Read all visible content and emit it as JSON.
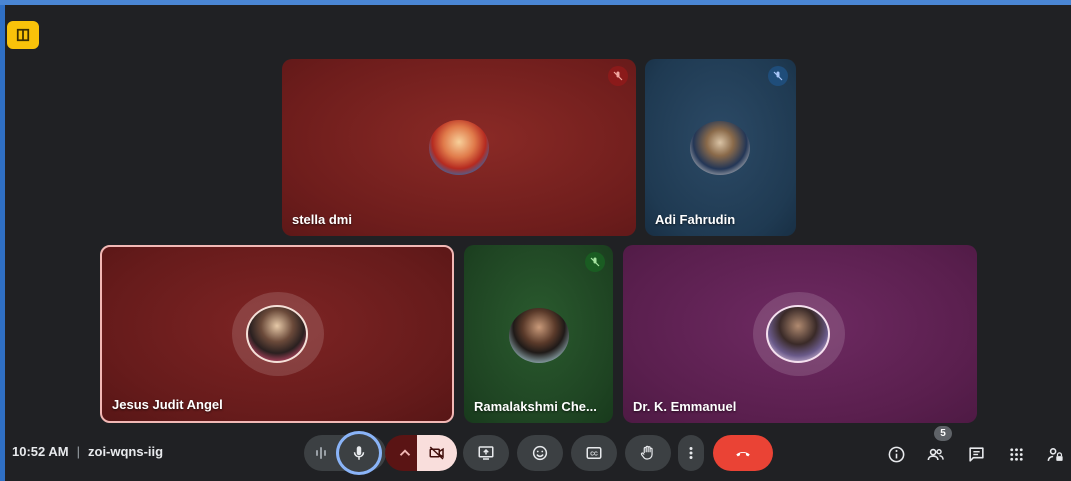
{
  "meeting": {
    "time": "10:52 AM",
    "separator": "|",
    "code": "zoi-wqns-iig"
  },
  "participants": [
    {
      "name": "stella dmi",
      "muted": true,
      "color": "#7a1f1f"
    },
    {
      "name": "Adi Fahrudin",
      "muted": true,
      "color": "#1f3a52"
    },
    {
      "name": "Jesus Judit Angel",
      "muted": false,
      "color": "#6b1a1a",
      "speaking": true
    },
    {
      "name": "Ramalakshmi Che...",
      "muted": true,
      "color": "#1e4322"
    },
    {
      "name": "Dr. K. Emmanuel",
      "muted": false,
      "color": "#5a1f4e"
    }
  ],
  "controls": {
    "participant_count": "5",
    "mic": "mic-icon",
    "camera": "camera-off-icon",
    "present": "present-icon",
    "reactions": "emoji-icon",
    "captions": "captions-icon",
    "raise_hand": "hand-icon",
    "more": "more-vert-icon",
    "leave": "end-call-icon"
  },
  "colors": {
    "background": "#202124",
    "leave": "#ea4335",
    "camera_off_bg": "#f9dedc",
    "mic_ring": "#8ab4f8"
  }
}
